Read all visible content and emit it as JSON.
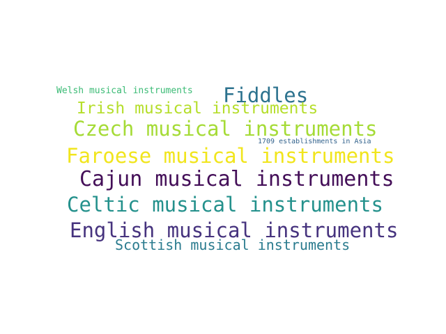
{
  "words": [
    {
      "text": "Welsh musical instruments",
      "color": "#3bbb75"
    },
    {
      "text": "Fiddles",
      "color": "#2c728e"
    },
    {
      "text": "Irish musical instruments",
      "color": "#b5de2b"
    },
    {
      "text": "Czech musical instruments",
      "color": "#a5db36"
    },
    {
      "text": "1709 establishments in Asia",
      "color": "#33638d"
    },
    {
      "text": "Faroese musical instruments",
      "color": "#f1e51d"
    },
    {
      "text": "Cajun musical instruments",
      "color": "#440f58"
    },
    {
      "text": "Celtic musical instruments",
      "color": "#24918c"
    },
    {
      "text": "English musical instruments",
      "color": "#46337e"
    },
    {
      "text": "Scottish musical instruments",
      "color": "#2a7b8e"
    }
  ]
}
